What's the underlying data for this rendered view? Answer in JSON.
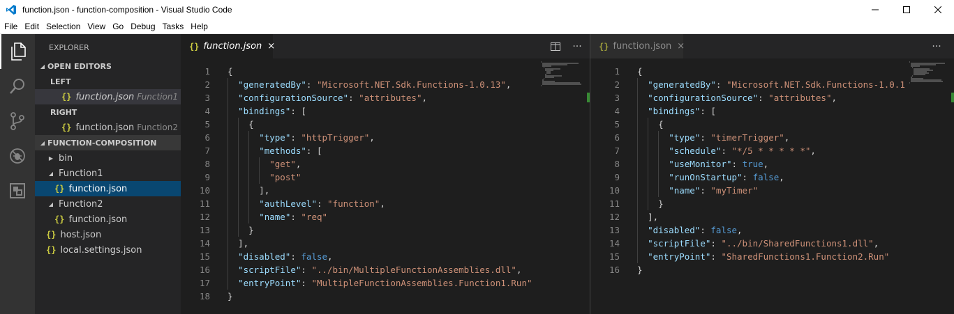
{
  "window": {
    "title": "function.json - function-composition - Visual Studio Code",
    "controls": [
      "minimize-icon",
      "maximize-icon",
      "close-icon"
    ]
  },
  "menu": [
    "File",
    "Edit",
    "Selection",
    "View",
    "Go",
    "Debug",
    "Tasks",
    "Help"
  ],
  "activity": [
    "files-icon",
    "search-icon",
    "source-control-icon",
    "debug-icon",
    "extensions-icon"
  ],
  "sidebar": {
    "title": "EXPLORER",
    "open_editors": "OPEN EDITORS",
    "left_label": "LEFT",
    "left_file": "function.json",
    "left_desc": "Function1",
    "right_label": "RIGHT",
    "right_file": "function.json",
    "right_desc": "Function2",
    "project": "FUNCTION-COMPOSITION",
    "tree": {
      "bin": "bin",
      "function1": "Function1",
      "function1_file": "function.json",
      "function2": "Function2",
      "function2_file": "function.json",
      "host": "host.json",
      "local": "local.settings.json"
    }
  },
  "left_editor": {
    "tab_label": "function.json",
    "tab_close": "×",
    "split_icon": "split-editor-icon",
    "more": "···"
  },
  "right_editor": {
    "tab_label": "function.json",
    "tab_close": "×",
    "more": "···"
  },
  "left_code": [
    "{",
    "  \"generatedBy\": \"Microsoft.NET.Sdk.Functions-1.0.13\",",
    "  \"configurationSource\": \"attributes\",",
    "  \"bindings\": [",
    "    {",
    "      \"type\": \"httpTrigger\",",
    "      \"methods\": [",
    "        \"get\",",
    "        \"post\"",
    "      ],",
    "      \"authLevel\": \"function\",",
    "      \"name\": \"req\"",
    "    }",
    "  ],",
    "  \"disabled\": false,",
    "  \"scriptFile\": \"../bin/MultipleFunctionAssemblies.dll\",",
    "  \"entryPoint\": \"MultipleFunctionAssemblies.Function1.Run\"",
    "}"
  ],
  "right_code": [
    "{",
    "  \"generatedBy\": \"Microsoft.NET.Sdk.Functions-1.0.1",
    "  \"configurationSource\": \"attributes\",",
    "  \"bindings\": [",
    "    {",
    "      \"type\": \"timerTrigger\",",
    "      \"schedule\": \"*/5 * * * * *\",",
    "      \"useMonitor\": true,",
    "      \"runOnStartup\": false,",
    "      \"name\": \"myTimer\"",
    "    }",
    "  ],",
    "  \"disabled\": false,",
    "  \"scriptFile\": \"../bin/SharedFunctions1.dll\",",
    "  \"entryPoint\": \"SharedFunctions1.Function2.Run\"",
    "}"
  ],
  "colors": {
    "key": "#9cdcfe",
    "string": "#ce9178",
    "keyword": "#569cd6",
    "json_icon": "#cbcb41",
    "selection": "#094771"
  }
}
